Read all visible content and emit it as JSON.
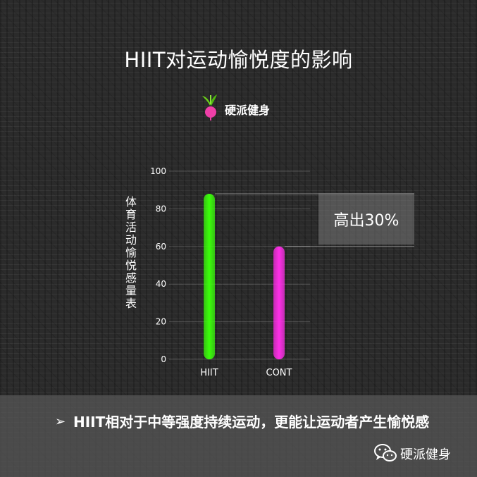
{
  "title": "HIIT对运动愉悦度的影响",
  "logo": {
    "text": "硬派健身"
  },
  "chart_data": {
    "type": "bar",
    "categories": [
      "HIIT",
      "CONT"
    ],
    "values": [
      88,
      60
    ],
    "colors": [
      "#3bff0a",
      "#ff2ee8"
    ],
    "ylabel": "体育活动愉悦感量表",
    "ylim": [
      0,
      100
    ],
    "yticks": [
      0,
      20,
      40,
      60,
      80,
      100
    ],
    "grid": true,
    "annotation": "高出30%"
  },
  "footer": {
    "bullet_symbol": "➢",
    "bullet_text": "HIIT相对于中等强度持续运动，更能让运动者产生愉悦感",
    "wechat_name": "硬派健身"
  }
}
